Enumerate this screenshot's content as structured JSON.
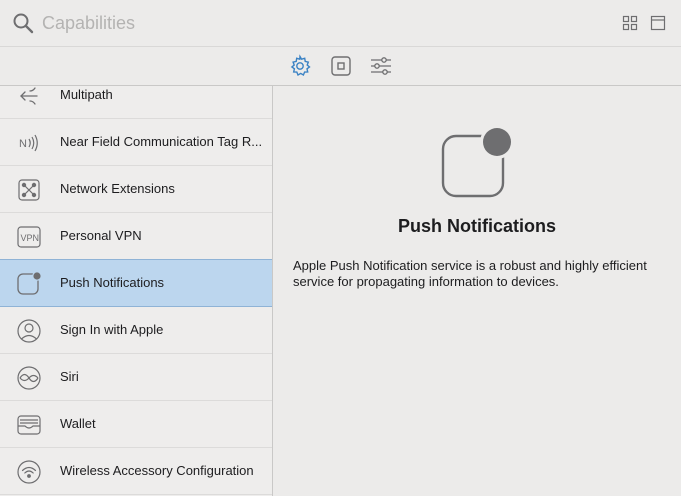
{
  "search": {
    "placeholder": "Capabilities",
    "value": ""
  },
  "toolbar": {
    "grid_icon": "grid-view-icon",
    "library_icon": "library-icon"
  },
  "tabs": [
    {
      "name": "capabilities",
      "icon": "gear-icon",
      "selected": true
    },
    {
      "name": "objects",
      "icon": "square-icon",
      "selected": false
    },
    {
      "name": "attributes",
      "icon": "sliders-icon",
      "selected": false
    }
  ],
  "sidebar": {
    "items": [
      {
        "label": "Multipath",
        "icon": "multipath-icon"
      },
      {
        "label": "Near Field Communication Tag R...",
        "icon": "nfc-icon"
      },
      {
        "label": "Network Extensions",
        "icon": "network-extensions-icon"
      },
      {
        "label": "Personal VPN",
        "icon": "vpn-icon"
      },
      {
        "label": "Push Notifications",
        "icon": "push-notifications-icon",
        "selected": true
      },
      {
        "label": "Sign In with Apple",
        "icon": "apple-signin-icon"
      },
      {
        "label": "Siri",
        "icon": "siri-icon"
      },
      {
        "label": "Wallet",
        "icon": "wallet-icon"
      },
      {
        "label": "Wireless Accessory Configuration",
        "icon": "wifi-icon"
      }
    ]
  },
  "detail": {
    "title": "Push Notifications",
    "description": "Apple Push Notification service is a robust and highly efficient service for propagating information to devices.",
    "icon": "push-notifications-icon"
  },
  "colors": {
    "selection": "#bcd6ee",
    "background": "#ecebea",
    "accent": "#3b82c4",
    "icon_gray": "#6e6e70"
  }
}
